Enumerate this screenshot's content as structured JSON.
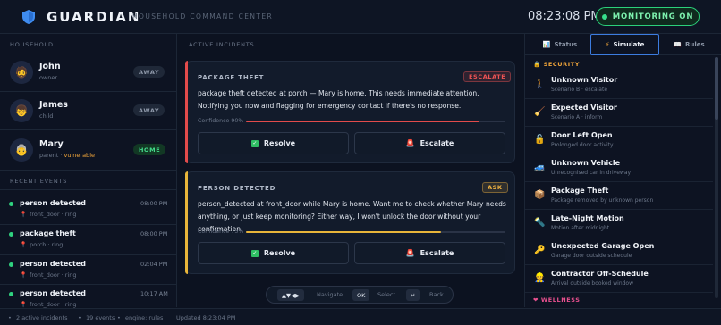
{
  "header": {
    "brand": "GUARDIAN",
    "subtitle": "HOUSEHOLD COMMAND CENTER",
    "clock": "08:23:08 PM",
    "monitor_label": "MONITORING ON"
  },
  "household": {
    "title": "HOUSEHOLD",
    "members": [
      {
        "name": "John",
        "role": "owner",
        "role_extra": "",
        "status": "AWAY",
        "avatar": "man-icon"
      },
      {
        "name": "James",
        "role": "child",
        "role_extra": "",
        "status": "AWAY",
        "avatar": "child-icon"
      },
      {
        "name": "Mary",
        "role": "parent · ",
        "role_extra": "vulnerable",
        "status": "HOME",
        "avatar": "elder-icon"
      }
    ]
  },
  "events": {
    "title": "RECENT EVENTS",
    "items": [
      {
        "title": "person detected",
        "time": "08:00 PM",
        "location": "front_door · ring"
      },
      {
        "title": "package theft",
        "time": "08:00 PM",
        "location": "porch · ring"
      },
      {
        "title": "person detected",
        "time": "02:04 PM",
        "location": "front_door · ring"
      },
      {
        "title": "person detected",
        "time": "10:17 AM",
        "location": "front_door · ring"
      }
    ]
  },
  "incidents": {
    "title": "ACTIVE INCIDENTS",
    "cards": [
      {
        "type": "PACKAGE THEFT",
        "tag": "ESCALATE",
        "tag_color": "#f05454",
        "stripe": "#e24b4b",
        "message": "package theft detected at porch — Mary is home. This needs immediate attention. Notifying you now and flagging for emergency contact if there's no response.",
        "confidence_label": "Confidence 90%",
        "confidence": 0.9,
        "resolve": "Resolve",
        "escalate": "Escalate"
      },
      {
        "type": "PERSON DETECTED",
        "tag": "ASK",
        "tag_color": "#f2b441",
        "stripe": "#e8b53a",
        "message": "person_detected at front_door while Mary is home. Want me to check whether Mary needs anything, or just keep monitoring? Either way, I won't unlock the door without your confirmation.",
        "confidence_label": "Confidence 75%",
        "confidence": 0.75,
        "resolve": "Resolve",
        "escalate": "Escalate"
      }
    ]
  },
  "navhint": {
    "arrows": "▲▼◀▶",
    "navigate": "Navigate",
    "ok": "OK",
    "select": "Select",
    "back_key": "↵",
    "back": "Back"
  },
  "tabs": [
    {
      "label": "Status",
      "icon": "chart-icon",
      "active": false
    },
    {
      "label": "Simulate",
      "icon": "bolt-icon",
      "active": true
    },
    {
      "label": "Rules",
      "icon": "book-icon",
      "active": false
    }
  ],
  "simulate": {
    "security_label": "SECURITY",
    "wellness_label": "WELLNESS",
    "scenarios": [
      {
        "title": "Unknown Visitor",
        "sub": "Scenario B · escalate",
        "icon": "walker-icon",
        "glyph": "🚶"
      },
      {
        "title": "Expected Visitor",
        "sub": "Scenario A · inform",
        "icon": "broom-icon",
        "glyph": "🧹"
      },
      {
        "title": "Door Left Open",
        "sub": "Prolonged door activity",
        "icon": "unlock-icon",
        "glyph": "🔓"
      },
      {
        "title": "Unknown Vehicle",
        "sub": "Unrecognised car in driveway",
        "icon": "car-icon",
        "glyph": "🚙"
      },
      {
        "title": "Package Theft",
        "sub": "Package removed by unknown person",
        "icon": "package-icon",
        "glyph": "📦"
      },
      {
        "title": "Late-Night Motion",
        "sub": "Motion after midnight",
        "icon": "flashlight-icon",
        "glyph": "🔦"
      },
      {
        "title": "Unexpected Garage Open",
        "sub": "Garage door outside schedule",
        "icon": "key-icon",
        "glyph": "🔑"
      },
      {
        "title": "Contractor Off-Schedule",
        "sub": "Arrival outside booked window",
        "icon": "worker-icon",
        "glyph": "👷"
      }
    ]
  },
  "footer": {
    "incidents": "2 active incidents",
    "events": "19 events",
    "engine": "engine: rules",
    "updated": "Updated 8:23:04 PM"
  },
  "colors": {
    "accent_green": "#2bd07a",
    "danger": "#e24b4b",
    "warning": "#e8b53a",
    "tab_active_border": "#3c7ce0"
  }
}
